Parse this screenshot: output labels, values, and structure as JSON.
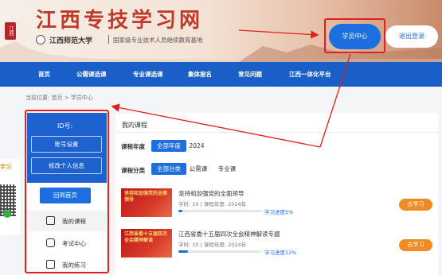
{
  "header": {
    "site_title": "江西专技学习网",
    "seal_text": "江西",
    "university_name": "江西师范大学",
    "slogan": "国家级专业技术人员继续教育基地",
    "student_center": "学员中心",
    "logout": "退出登录"
  },
  "nav": {
    "items": [
      "首页",
      "公需课选课",
      "专业课选课",
      "集体报名",
      "常见问题",
      "江西一体化平台"
    ]
  },
  "breadcrumb": {
    "prefix": "当前位置:",
    "home": "首页",
    "sep": ">",
    "current": "学员中心"
  },
  "sidebar": {
    "id_label": "ID号:",
    "account_settings": "账号设置",
    "edit_profile": "修改个人信息",
    "back_home": "回到首页",
    "menu": [
      {
        "label": "我的课程",
        "icon": "book-icon"
      },
      {
        "label": "考试中心",
        "icon": "exam-icon"
      },
      {
        "label": "我的练习",
        "icon": "calendar-icon"
      }
    ]
  },
  "side_float": {
    "label": "学习"
  },
  "main": {
    "title": "我的课程",
    "year_label": "课程年度",
    "year_options": [
      "全部年度",
      "2024"
    ],
    "category_label": "课程分类",
    "category_options": [
      "全部分类",
      "公需课",
      "专业课"
    ],
    "courses": [
      {
        "thumb_text": "坚持和加强党的全面领导",
        "title": "坚持和加强党的全面领导",
        "meta": "学时: 10 | 课程年度: 2024年",
        "progress_pct": 5,
        "progress_text": "学习进度5%",
        "button": "去学习"
      },
      {
        "thumb_text": "江西省委十五届四次全会精神解读",
        "title": "江西省委十五届四次全会精神解读专题",
        "meta": "学时: 10 | 课程年度: 2024年",
        "progress_pct": 12,
        "progress_text": "学习进度12%",
        "button": "去学习"
      }
    ]
  },
  "colors": {
    "primary": "#1d6fe0",
    "nav": "#1a5fc8",
    "accent_orange": "#f08a24",
    "title_red": "#c0392b",
    "annotation_red": "#e02020"
  }
}
